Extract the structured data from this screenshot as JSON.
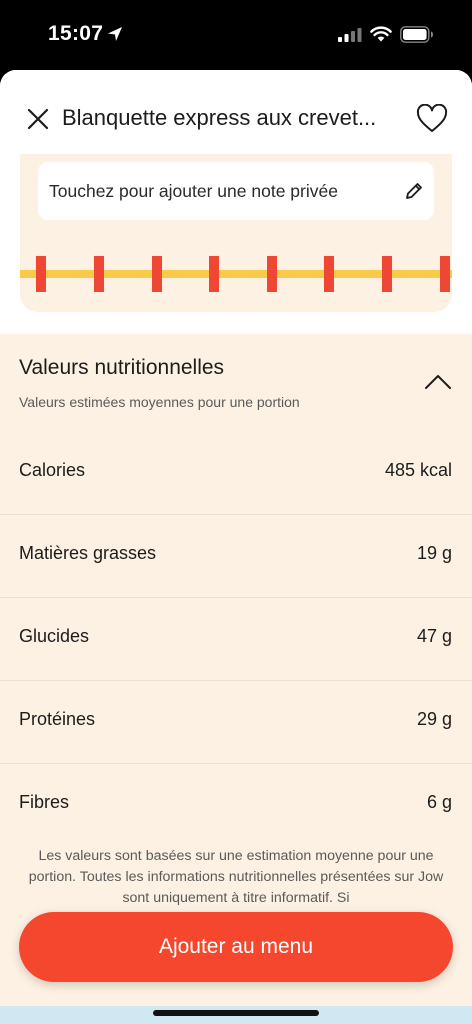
{
  "status_bar": {
    "time": "15:07"
  },
  "header": {
    "title": "Blanquette express aux crevet..."
  },
  "note": {
    "placeholder": "Touchez pour ajouter une note privée"
  },
  "nutrition": {
    "title": "Valeurs nutritionnelles",
    "subtitle": "Valeurs estimées moyennes pour une portion",
    "rows": [
      {
        "label": "Calories",
        "value": "485 kcal"
      },
      {
        "label": "Matières grasses",
        "value": "19 g"
      },
      {
        "label": "Glucides",
        "value": "47 g"
      },
      {
        "label": "Protéines",
        "value": "29 g"
      },
      {
        "label": "Fibres",
        "value": "6 g"
      }
    ],
    "disclaimer": "Les valeurs sont basées sur une estimation moyenne pour une portion. Toutes les informations nutritionnelles présentées sur Jow sont uniquement à titre informatif. Si"
  },
  "cta": {
    "label": "Ajouter au menu"
  },
  "colors": {
    "accent": "#f4472d",
    "cream": "#fdf1e3",
    "timeline_line": "#f9c94a",
    "timeline_mark": "#ee4734",
    "bottom_strip": "#cfe8f2"
  }
}
